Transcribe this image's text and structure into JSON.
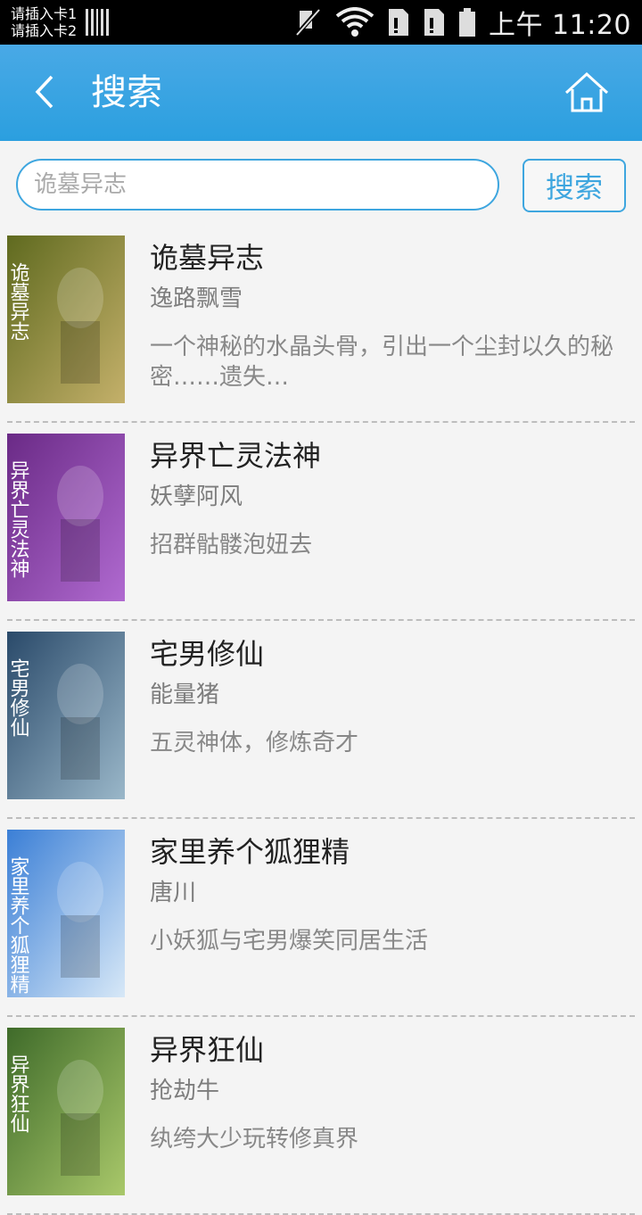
{
  "status_bar": {
    "sim1": "请插入卡1",
    "sim2": "请插入卡2",
    "time_prefix": "上午",
    "time": "11:20",
    "icons": [
      "sim-signal-icon",
      "mute-icon",
      "wifi-icon",
      "sim-card-icon",
      "sim-card-icon",
      "battery-icon"
    ]
  },
  "header": {
    "title": "搜索",
    "back_icon": "back-chevron-icon",
    "home_icon": "home-icon",
    "background": "#2b9fdf"
  },
  "search": {
    "placeholder": "诡墓异志",
    "button_label": "搜索",
    "accent": "#3ea6df"
  },
  "results": [
    {
      "title": "诡墓异志",
      "author": "逸路飘雪",
      "description": "一个神秘的水晶头骨，引出一个尘封以久的秘密……遗失…",
      "cover_colors": [
        "#5f6a1f",
        "#c4b06a"
      ],
      "cover_text": "诡墓异志"
    },
    {
      "title": "异界亡灵法神",
      "author": "妖孽阿风",
      "description": "招群骷髅泡妞去",
      "cover_colors": [
        "#6a2a86",
        "#b06ad0"
      ],
      "cover_text": "异界亡灵法神"
    },
    {
      "title": "宅男修仙",
      "author": "能量猪",
      "description": "五灵神体，修炼奇才",
      "cover_colors": [
        "#2a4a6a",
        "#9ab7c9"
      ],
      "cover_text": "宅男修仙"
    },
    {
      "title": "家里养个狐狸精",
      "author": "唐川",
      "description": "小妖狐与宅男爆笑同居生活",
      "cover_colors": [
        "#3b7fd6",
        "#d7e8f7"
      ],
      "cover_text": "家里养个狐狸精"
    },
    {
      "title": "异界狂仙",
      "author": "抢劫牛",
      "description": "纨绔大少玩转修真界",
      "cover_colors": [
        "#3f6b2a",
        "#a9c86a"
      ],
      "cover_text": "异界狂仙"
    }
  ]
}
